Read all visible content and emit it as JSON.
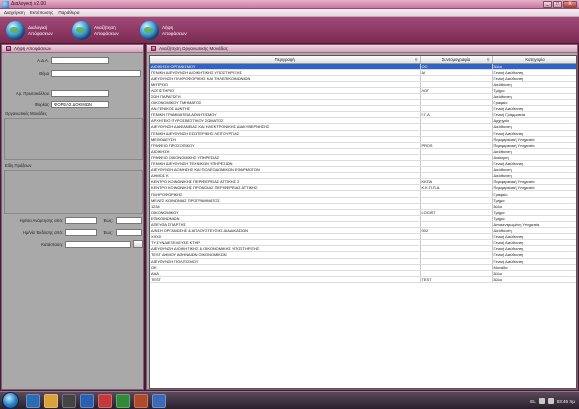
{
  "window": {
    "title": "Διαλογική v2.00",
    "btn_min": "_",
    "btn_max": "□",
    "btn_close": "X"
  },
  "menu": [
    "Διαχείριση",
    "Εκτύπωσης",
    "Παράθυρα"
  ],
  "toolbar": [
    {
      "label": "Διαλογική Απόφασεων"
    },
    {
      "label": "Αναζήτηση Αποφάσεων"
    },
    {
      "label": "Λήψη Αποφάσεων"
    }
  ],
  "left_panel": {
    "title": "Λήψη Αποφάσεων",
    "fields": {
      "ada_label": "Α.Δ.Α.",
      "ada_value": "",
      "thema_label": "Θέμα",
      "thema_value": "",
      "arprot_label": "Αρ. Πρωτοκόλλου",
      "arprot_value": "",
      "foreas_label": "Φορέας",
      "foreas_value": "ΦΟΡΕΑΣ ΔΟΚΙΜΩΝ",
      "org_label": "Οργανωτικές Μονάδες",
      "eidi_label": "Είδη Πράξεων",
      "date_anart_label": "Ημ/νία Ανάρτησης από:",
      "date_ekd_label": "Ημ/νία Έκδοσης από:",
      "eos_label": "Έως:",
      "katastasi_label": "Κατάσταση:"
    }
  },
  "right_panel": {
    "title": "Αναζήτηση Οργανωτικής Μονάδας",
    "columns": [
      "Περιγραφή",
      "Συντομογραφία",
      "Κατηγορία"
    ],
    "rows": [
      [
        "ΔΙΟΙΚΗΣΗ ΟΡΓΑΝΙΣΜΟΥ",
        "ΟΟ",
        "Άλλο"
      ],
      [
        "ΓΕΝΙΚΗ ΔΙΕΥΘΥΝΣΗ ΔΙΟΙΚΗΤΙΚΗΣ ΥΠΟΣΤΗΡΙΞΗΣ",
        "ΔΙ",
        "Γενική Διεύθυνση"
      ],
      [
        "ΔΙΕΥΘΥΝΣΗ ΠΛΗΡΟΦΟΡΙΚΗΣ ΚΑΙ ΤΗΛΕΠΙΚΟΙΝΩΝΙΩΝ",
        "",
        "Γενική Διεύθυνση"
      ],
      [
        "ΜΗΤΡΩΟ",
        "",
        "Διεύθυνση"
      ],
      [
        "ΛΟΓΙΣΤΗΡΙΟ",
        "ΛΟΓ",
        "Τμήμα"
      ],
      [
        "ΣΩΗ ΠΑΡΑΓΩΓΗ",
        "",
        "Διεύθυνση"
      ],
      [
        "ΟΙΚΟΝΟΜΙΚΟΥ ΤΜΗΜΑΤΟΣ",
        "",
        "Γραφείο"
      ],
      [
        "ΑΝ.ΓΕΝΙΚΟΣ ΔΙ/ΝΤΗΣ",
        "",
        "Γενική Διεύθυνση"
      ],
      [
        "ΓΕΝΙΚΗ ΓΡΑΜΜΑΤΕΙΑ ΑΘΛΗΤΙΣΜΟΥ",
        "Γ.Γ.Α.",
        "Γενική Γραμματεία"
      ],
      [
        "ΑΡΧΗΓΕΙΟ ΠΥΡΟΣΒΕΣΤΙΚΟΥ ΣΩΜΑΤΟΣ",
        "",
        "Αρχηγείο"
      ],
      [
        "ΔΙΕΥΘΥΝΣΗ ΔΙΑΦΑΝΕΙΑΣ ΚΑΙ ΗΛΕΚΤΡΟΝΙΚΗΣ ΔΙΑΚΥΒΕΡΝΗΣΗΣ",
        "",
        "Διεύθυνση"
      ],
      [
        "ΓΕΝΙΚΗ ΔΙΕΥΘΥΝΣΗ ΕΣΩΤΕΡΙΚΗΣ ΛΕΙΤΟΥΡΓΙΑΣ",
        "",
        "Γενική Διεύθυνση"
      ],
      [
        "ΜΕΘΟΔΕΥΣΗ",
        "",
        "Περιφερειακή Υπηρεσία"
      ],
      [
        "ΓΡΑΦΕΙΟ ΠΡΟΣΟΠΙΚΟΥ",
        "PROS",
        "Περιφερειακή Υπηρεσία"
      ],
      [
        "ΔΙΟΙΚΗΣΗ",
        "",
        "Διεύθυνση"
      ],
      [
        "ΓΡΑΦΕΙΟ ΟΙΚΟΝΟΜΙΚΗΣ ΥΠΗΡΕΣΙΑΣ",
        "",
        "Διοίκηση"
      ],
      [
        "ΓΕΝΙΚΗ ΔΙΕΥΘΥΝΣΗ ΤΕΧΝΙΚΩΝ ΥΠΗΡΕΣΙΩΝ",
        "",
        "Γενική Διεύθυνση"
      ],
      [
        "ΔΙΕΥΘΥΝΣΗ ΔΟΜΗΣΗΣ ΚΑΙ ΠΟΛΕΟΔΟΜΙΚΩΝ ΕΦΑΡΜΟΓΩΝ",
        "",
        "Διεύθυνση"
      ],
      [
        "ΔΗΜΟΣ Κ",
        "",
        "Διεύθυνση"
      ],
      [
        "ΚΕΝΤΡΟ ΚΟΙΝΩΝΙΚΗΣ ΠΕΡΙΦΕΡΕΙΑΣ ΑΤΤΙΚΗΣ 2",
        "ΚΚΠΑ",
        "Περιφερειακή Υπηρεσία"
      ],
      [
        "ΚΕΝΤΡΟ ΚΟΙΝΩΝΙΚΗΣ ΠΡΟΝΟΙΑΣ ΠΕΡΙΦΕΡΕΙΑΣ ΑΤΤΙΚΗΣ",
        "Κ.Κ.Π.Π.Α.",
        "Περιφερειακή Υπηρεσία"
      ],
      [
        "ΠΛΗΡΟΦΟΡΙΚΗΣ",
        "",
        "Γραφείο"
      ],
      [
        "ΜΕΛΕΣ ΚΟΙΝΩΝΙΑΣ ΠΡΟΓΡΑΜΜΑΤΟΣ",
        "",
        "Τμήμα"
      ],
      [
        "1234",
        "",
        "Άλλο"
      ],
      [
        "ΟΙΚΟΝΟΜΙΚΟΥ",
        "LOGIST",
        "Τμήμα"
      ],
      [
        "ΕΠΙΚΟΙΝΩΝΙΩΝ",
        "",
        "Τμήμα"
      ],
      [
        "ΑΠΕΥΘΑ ΣΠΑΡΤΗΣ",
        "",
        "Αποκεντρωμένη Υπηρεσία"
      ],
      [
        "Δ/ΝΣΗ ΟΡΓΑΝΩΣΗΣ & ΑΠΛΟΥΣΤΕΥΣΗΣ ΔΙΑΔΙΚΑΣΙΩΝ",
        "002",
        "Διεύθυνση"
      ],
      [
        "XXXX",
        "",
        "Γενική Διεύθυνση"
      ],
      [
        "ΤΥ.ΣΥΝΔΙΕΞΕΛΕΥΣΕ ΚΤΗΡ.",
        "",
        "Γενική Διεύθυνση"
      ],
      [
        "ΔΙΕΥΘΥΝΣΗ ΔΙΟΙΚΗΤΙΚΗΣ & ΟΙΚΟΝΟΜΙΚΗΣ ΥΠΟΣΤΗΡΙΞΗΣ",
        "",
        "Γενική Διεύθυνση"
      ],
      [
        "TEST ΔΗΜΟΥ ΑΘΗΝΑΙΩΝ ΟΙΚΟΝΟΜΙΚΩΝ",
        "",
        "Γενική Διεύθυνση"
      ],
      [
        "ΔΙΕΥΘΥΝΣΗ ΠΟΛΙΤΙΣΜΟΥ",
        "",
        "Γενική Διεύθυνση"
      ],
      [
        "ΟΚ",
        "",
        "Μονάδα"
      ],
      [
        "ΑΑΑ",
        "",
        "Άλλο"
      ],
      [
        "TEST",
        "TEST",
        "Άλλο"
      ]
    ]
  },
  "taskbar": {
    "lang": "EL",
    "time": "03:46 πμ"
  }
}
